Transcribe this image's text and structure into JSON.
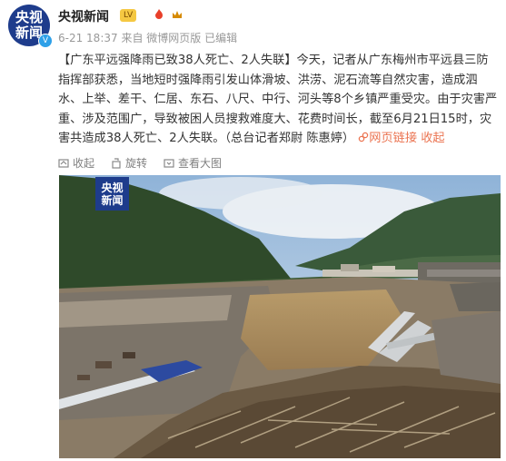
{
  "author": {
    "name": "央视新闻",
    "avatar_line1": "央视",
    "avatar_line2": "新闻",
    "level": "LV",
    "verified_mark": "V"
  },
  "post": {
    "meta": "6-21 18:37 来自 微博网页版 已编辑",
    "title": "【广东平远强降雨已致38人死亡、2人失联】",
    "body": "今天，记者从广东梅州市平远县三防指挥部获悉，当地短时强降雨引发山体滑坡、洪涝、泥石流等自然灾害，造成泗水、上举、差干、仁居、东石、八尺、中行、河头等8个乡镇严重受灾。由于灾害严重、涉及范围广，导致被困人员搜救难度大、花费时间长，截至6月21日15时，灾害共造成38人死亡、2人失联。（总台记者郑尉 陈惠婷）",
    "link_label": "网页链接",
    "collapse_label": "收起",
    "link_icon": "link-icon"
  },
  "actions": {
    "favorite": "收起",
    "rotate": "旋转",
    "view_large": "查看大图"
  },
  "photo": {
    "logo_line1": "央视",
    "logo_line2": "新闻"
  }
}
